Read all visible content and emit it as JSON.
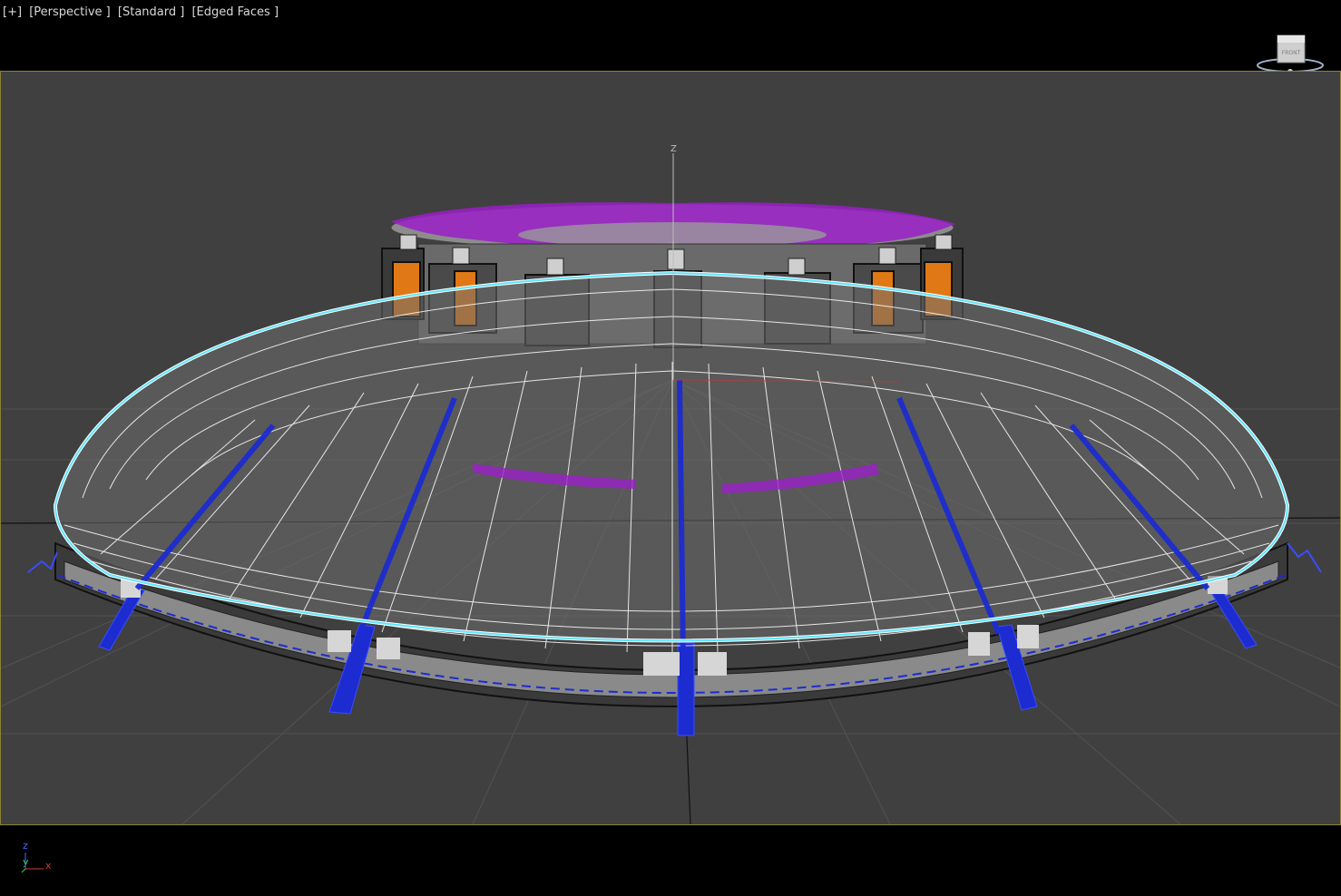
{
  "viewport": {
    "labels": [
      "[+]",
      "[Perspective ]",
      "[Standard ]",
      "[Edged Faces ]"
    ],
    "gizmo_axis_label": "Z"
  },
  "viewcube": {
    "face_label": "FRONT",
    "icon": "viewcube-icon"
  },
  "axis_tripod": {
    "z": "z",
    "y": "y",
    "x": "x"
  },
  "colors": {
    "background": "#404040",
    "frame_border": "#8a8434",
    "selection_outline": "#5ee4ff",
    "wire_blue": "#1c2cd0",
    "purple_mesh": "#9a1fc8",
    "orange_part": "#e07816"
  },
  "scene_objects": [
    "dome-wireframe",
    "turret-ring",
    "rotor-blocks",
    "base-disk",
    "support-legs"
  ]
}
